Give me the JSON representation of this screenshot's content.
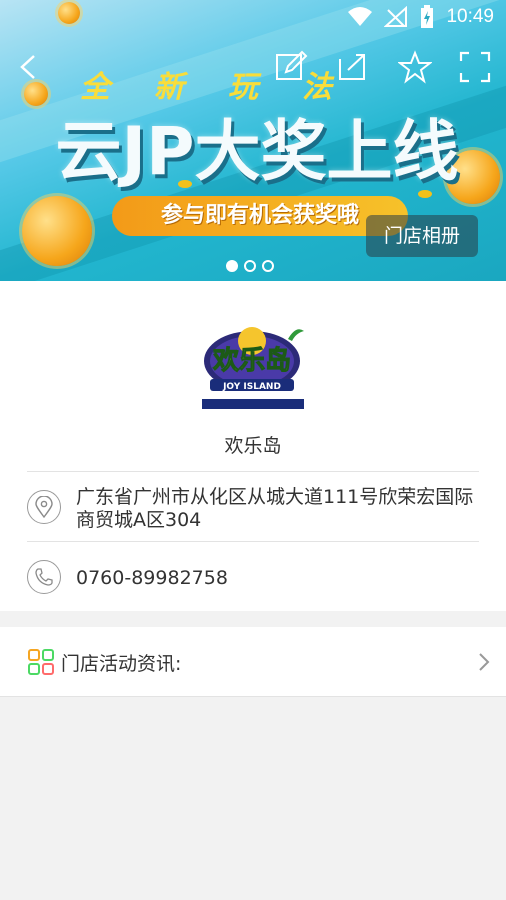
{
  "status_bar": {
    "time": "10:49"
  },
  "banner": {
    "kicker": "全新玩法",
    "headline": "云JP大奖上线",
    "pill": "参与即有机会获奖哦",
    "album_button": "门店相册",
    "page_count": 3,
    "active_page": 1
  },
  "store": {
    "logo_text": "欢乐岛",
    "logo_sub": "JOY ISLAND",
    "name": "欢乐岛",
    "address": "广东省广州市从化区从城大道111号欣荣宏国际商贸城A区304",
    "phone": "0760-89982758"
  },
  "news": {
    "label": "门店活动资讯:"
  },
  "colors": {
    "accent_orange": "#f39a18",
    "banner_teal": "#22b6cf"
  }
}
